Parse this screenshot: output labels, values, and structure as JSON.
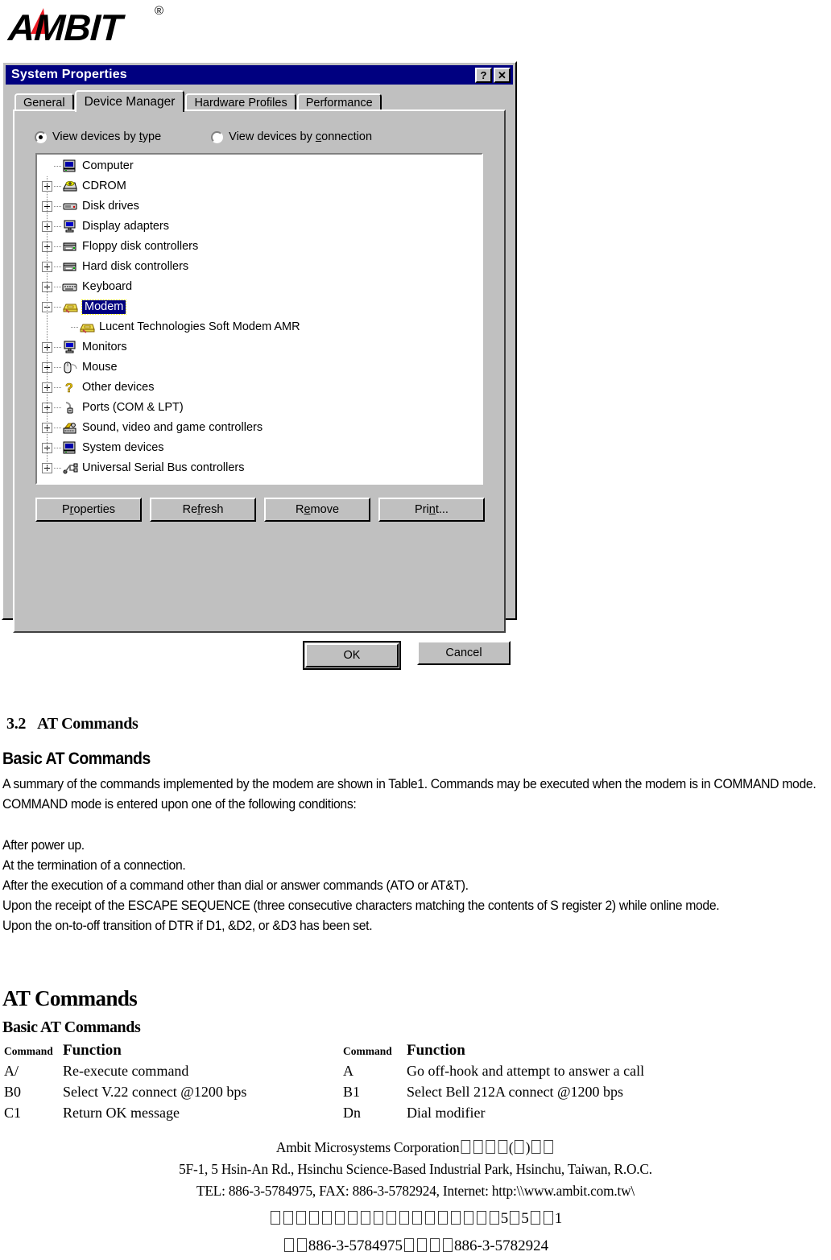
{
  "logo": {
    "brand": "AMBIT",
    "trademark": "®"
  },
  "dialog": {
    "title": "System Properties",
    "help_button": "?",
    "close_button": "✕",
    "tabs": [
      {
        "label": "General",
        "active": false
      },
      {
        "label": "Device Manager",
        "active": true
      },
      {
        "label": "Hardware Profiles",
        "active": false
      },
      {
        "label": "Performance",
        "active": false
      }
    ],
    "view_options": [
      {
        "label_pre": "View devices by ",
        "accel": "t",
        "label_post": "ype",
        "selected": true
      },
      {
        "label_pre": "View devices by ",
        "accel": "c",
        "label_post": "onnection",
        "selected": false
      }
    ],
    "tree": [
      {
        "label": "Computer",
        "level": 0,
        "expander": "none",
        "icon": "computer-icon",
        "selected": false
      },
      {
        "label": "CDROM",
        "level": 0,
        "expander": "collapsed",
        "icon": "cdrom-icon",
        "selected": false
      },
      {
        "label": "Disk drives",
        "level": 0,
        "expander": "collapsed",
        "icon": "disk-icon",
        "selected": false
      },
      {
        "label": "Display adapters",
        "level": 0,
        "expander": "collapsed",
        "icon": "display-icon",
        "selected": false
      },
      {
        "label": "Floppy disk controllers",
        "level": 0,
        "expander": "collapsed",
        "icon": "floppy-icon",
        "selected": false
      },
      {
        "label": "Hard disk controllers",
        "level": 0,
        "expander": "collapsed",
        "icon": "harddisk-icon",
        "selected": false
      },
      {
        "label": "Keyboard",
        "level": 0,
        "expander": "collapsed",
        "icon": "keyboard-icon",
        "selected": false
      },
      {
        "label": "Modem",
        "level": 0,
        "expander": "expanded",
        "icon": "modem-icon",
        "selected": true
      },
      {
        "label": "Lucent Technologies Soft Modem AMR",
        "level": 1,
        "expander": "none",
        "icon": "modem-icon",
        "selected": false
      },
      {
        "label": "Monitors",
        "level": 0,
        "expander": "collapsed",
        "icon": "monitor-icon",
        "selected": false
      },
      {
        "label": "Mouse",
        "level": 0,
        "expander": "collapsed",
        "icon": "mouse-icon",
        "selected": false
      },
      {
        "label": "Other devices",
        "level": 0,
        "expander": "collapsed",
        "icon": "question-icon",
        "selected": false
      },
      {
        "label": "Ports (COM & LPT)",
        "level": 0,
        "expander": "collapsed",
        "icon": "port-icon",
        "selected": false
      },
      {
        "label": "Sound, video and game controllers",
        "level": 0,
        "expander": "collapsed",
        "icon": "sound-icon",
        "selected": false
      },
      {
        "label": "System devices",
        "level": 0,
        "expander": "collapsed",
        "icon": "system-icon",
        "selected": false
      },
      {
        "label": "Universal Serial Bus controllers",
        "level": 0,
        "expander": "collapsed",
        "icon": "usb-icon",
        "selected": false
      }
    ],
    "tree_buttons": [
      {
        "pre": "P",
        "accel": "r",
        "post": "operties"
      },
      {
        "pre": "Re",
        "accel": "f",
        "post": "resh"
      },
      {
        "pre": "R",
        "accel": "e",
        "post": "move"
      },
      {
        "pre": "Pri",
        "accel": "n",
        "post": "t..."
      }
    ],
    "ok_label": "OK",
    "cancel_label": "Cancel",
    "colors": {
      "titlebar": "#000080",
      "face": "#c0c0c0",
      "selection": "#000080"
    }
  },
  "document": {
    "section_number": "3.2",
    "section_title": "AT Commands",
    "heading_basic_1": "Basic AT Commands",
    "paragraph_1": "A summary of  the commands implemented by the modem are shown in Table1. Commands may be executed when the modem is in COMMAND mode. COMMAND mode is entered upon one of the following conditions:",
    "paragraph_2": "After power up.\nAt the termination of a connection.\nAfter the execution of a command other than dial or answer commands (ATO or AT&T).\nUpon the receipt of the ESCAPE SEQUENCE (three consecutive characters matching the contents of S register 2) while online mode.\nUpon the on-to-off transition of DTR if D1, &D2, or &D3 has been set.",
    "heading_at": "AT Commands",
    "heading_basic_2": "Basic AT Commands"
  },
  "command_table": {
    "header_left_command": "Command",
    "header_left_function": "Function",
    "header_right_command": "Command",
    "header_right_function": "Function",
    "rows": [
      {
        "cmd_l": "A/",
        "fn_l": "Re-execute command",
        "cmd_r": "A",
        "fn_r": "Go off-hook and attempt to answer a call"
      },
      {
        "cmd_l": "B0",
        "fn_l": "Select V.22 connect @1200 bps",
        "cmd_r": "B1",
        "fn_r": "Select Bell 212A connect @1200 bps"
      },
      {
        "cmd_l": "C1",
        "fn_l": "Return OK message",
        "cmd_r": "Dn",
        "fn_r": "Dial modifier"
      }
    ]
  },
  "footer": {
    "line1_text": "Ambit Microsystems Corporation",
    "line1_tofu_a": 4,
    "line1_paren_open": "(",
    "line1_tofu_paren": 1,
    "line1_paren_close": ")",
    "line1_tofu_b": 2,
    "line2": "5F-1, 5 Hsin-An Rd., Hsinchu Science-Based Industrial Park, Hsinchu, Taiwan, R.O.C.",
    "line3": "TEL: 886-3-5784975, FAX: 886-3-5782924, Internet: http:\\\\www.ambit.com.tw\\",
    "line4_tofu_a": 18,
    "line4_num1": "5",
    "line4_tofu_b": 1,
    "line4_num2": "5",
    "line4_tofu_c": 2,
    "line4_num3": "1",
    "line5_tofu_a": 2,
    "line5_tel": "886-3-5784975",
    "line5_tofu_b": 4,
    "line5_fax": "886-3-5782924"
  }
}
